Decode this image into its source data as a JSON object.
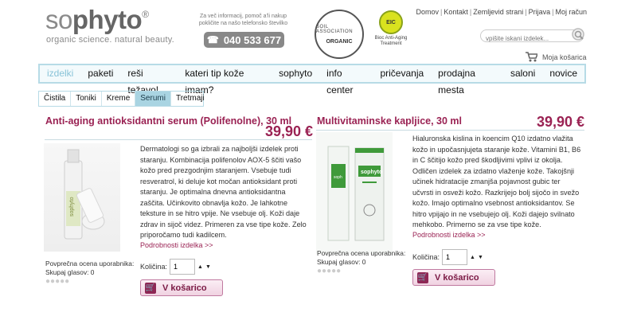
{
  "brand": {
    "logo_light": "so",
    "logo_bold": "phyto",
    "registered": "®",
    "tagline": "organic science. natural beauty."
  },
  "header": {
    "info_text": "Za več informacij, pomoč a'li nakup pokličite na našo telefonsko številko",
    "phone": "040 533 677",
    "seal_organic_ring": "SOIL ASSOCIATION",
    "seal_organic_center": "ORGANIC",
    "seal_eic": "EIC",
    "seal_eic_caption": "Bioc Anti-Aging Treatment"
  },
  "top_links": [
    "Domov",
    "Kontakt",
    "Zemljevid strani",
    "Prijava",
    "Moj račun"
  ],
  "search": {
    "placeholder": "vpišite iskani izdelek..."
  },
  "cart": {
    "label": "Moja košarica"
  },
  "nav": [
    {
      "label": "izdelki",
      "active": true
    },
    {
      "label": "paketi"
    },
    {
      "label": "reši težavo!"
    },
    {
      "label": "kateri tip kože imam?"
    },
    {
      "label": "sophyto"
    },
    {
      "label": "info center"
    },
    {
      "label": "pričevanja"
    },
    {
      "label": "prodajna mesta"
    },
    {
      "label": "saloni"
    },
    {
      "label": "novice"
    }
  ],
  "subnav": [
    {
      "label": "Čistila"
    },
    {
      "label": "Toniki"
    },
    {
      "label": "Kreme"
    },
    {
      "label": "Serumi",
      "active": true
    },
    {
      "label": "Tretmaji"
    }
  ],
  "products": [
    {
      "title": "Anti-aging antioksidantni serum (Polifenolne), 30 ml",
      "price": "39,90 €",
      "desc": "Dermatologi so ga izbrali za najboljši izdelek proti staranju. Kombinacija polifenolov AOX-5 ščiti vašo kožo pred prezgodnjim staranjem. Vsebuje tudi resveratrol, ki deluje kot močan antioksidant proti staranju. Je optimalna dnevna antioksidantna zaščita. Učinkovito obnavlja kožo. Je lahkotne teksture in se hitro vpije. Ne vsebuje olj. Koži daje zdrav in sijoč videz. Primeren za vse tipe kože. Zelo priporočamo tudi kadilcem.",
      "more": "Podrobnosti izdelka >>",
      "rating_label": "Povprečna ocena uporabnika:",
      "votes": "Skupaj glasov: 0",
      "qty_label": "Količina:",
      "qty": "1",
      "button": "V košarico"
    },
    {
      "title": "Multivitaminske kapljice, 30 ml",
      "price": "39,90 €",
      "desc": "Hialuronska kislina in koencim Q10 izdatno vlažita kožo in upočasnjujeta staranje kože. Vitamini B1, B6 in C ščitijo kožo pred škodljivimi vplivi iz okolja. Odličen izdelek za izdatno vlaženje kože. Takojšnji učinek hidratacije zmanjša pojavnost gubic ter učvrsti in osveži kožo. Razkrijejo bolj sijočo in svežo kožo. Imajo optimalno vsebnost antioksidantov. Se hitro vpijajo in ne vsebujejo olj. Koži dajejo svilnato mehkobo. Primerno se za vse tipe kože.",
      "more": "Podrobnosti izdelka >>",
      "rating_label": "Povprečna ocena uporabnika:",
      "votes": "Skupaj glasov: 0",
      "qty_label": "Količina:",
      "qty": "1",
      "button": "V košarico"
    }
  ],
  "colors": {
    "accent": "#9a2253",
    "nav_border": "#b7dbe6",
    "nav_active": "#88c3d8"
  }
}
